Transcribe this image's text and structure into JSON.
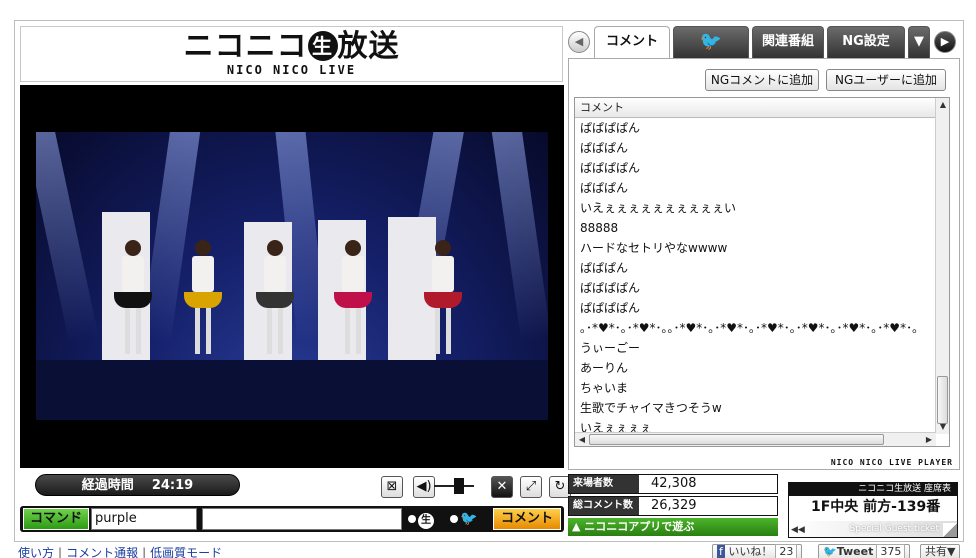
{
  "logo": {
    "main_left": "ニコニコ",
    "nama": "生",
    "main_right": "放送",
    "sub": "NICO NICO LIVE"
  },
  "player": {
    "elapsed_label": "経過時間",
    "elapsed_time": "24:19",
    "controls": [
      "ng-toggle-icon",
      "speaker-icon",
      "volume-slider",
      "comment-hide-icon",
      "fullscreen-icon",
      "reload-icon"
    ]
  },
  "command": {
    "button_label": "コマンド",
    "value": "purple",
    "comment_value": "",
    "target_nama": "生",
    "comment_button_label": "コメント"
  },
  "tabs": {
    "prev_arrow": "◀",
    "comment": "コメント",
    "twitter": "twitter-bird-icon",
    "related": "関連番組",
    "ng": "NG設定",
    "dropdown": "▼",
    "next_arrow": "▶"
  },
  "comment_panel": {
    "ng_comment_button": "NGコメントに追加",
    "ng_user_button": "NGユーザーに追加",
    "column_header": "コメント",
    "rows": [
      "ぱぱぱぱん",
      "ぱぱぱん",
      "ぱぱぱぱん",
      "ぱぱぱん",
      "いえぇぇぇぇぇぇぇぇぇぇい",
      "88888",
      "ハードなセトリやなwwww",
      "ぱぱぱん",
      "ぱぱぱぱん",
      "ぱぱぱぱん",
      "｡･*♥*･｡･*♥*･｡｡･*♥*･｡･*♥*･｡･*♥*･｡･*♥*･｡･*♥*･｡･*♥*･｡",
      "うぃーごー",
      "あーりん",
      "ちゃいま",
      "生歌でチャイマきつそうw",
      "いえぇぇぇぇ"
    ],
    "brand": "NICO NICO LIVE PLAYER"
  },
  "stats": {
    "visitors_label": "来場者数",
    "visitors_value": "42,308",
    "comments_label": "総コメント数",
    "comments_value": "26,329",
    "app_bar": "▲ ニコニコアプリで遊ぶ"
  },
  "seat": {
    "title": "ニコニコ生放送 座席表",
    "value": "1F中央 前方-139番",
    "footer": "Special Guest ticket"
  },
  "footer": {
    "links": [
      "使い方",
      "コメント通報",
      "低画質モード"
    ],
    "like_label": "いいね！",
    "like_count": "23",
    "tweet_label": "Tweet",
    "tweet_count": "375",
    "share_label": "共有▼"
  }
}
